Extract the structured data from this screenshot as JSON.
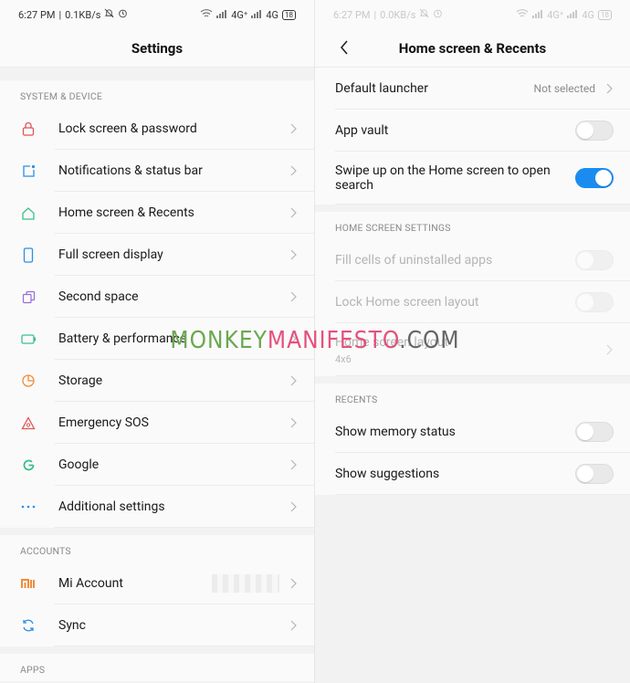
{
  "left": {
    "status": {
      "time": "6:27 PM",
      "speed": "0.1KB/s",
      "net1": "4G⁺",
      "net2": "4G",
      "battery": "18"
    },
    "title": "Settings",
    "sections": [
      {
        "header": "SYSTEM & DEVICE",
        "items": [
          {
            "label": "Lock screen & password",
            "icon": "lock-icon",
            "color": "#e05555"
          },
          {
            "label": "Notifications & status bar",
            "icon": "notification-icon",
            "color": "#2d8ee8"
          },
          {
            "label": "Home screen & Recents",
            "icon": "home-icon",
            "color": "#3cbf8a"
          },
          {
            "label": "Full screen display",
            "icon": "phone-icon",
            "color": "#2d8ee8"
          },
          {
            "label": "Second space",
            "icon": "second-space-icon",
            "color": "#9b6bd6"
          },
          {
            "label": "Battery & performance",
            "icon": "battery-icon",
            "color": "#3cbf8a"
          },
          {
            "label": "Storage",
            "icon": "storage-icon",
            "color": "#f08c3c"
          },
          {
            "label": "Emergency SOS",
            "icon": "sos-icon",
            "color": "#e05555"
          },
          {
            "label": "Google",
            "icon": "google-icon",
            "color": "#3cbf8a"
          },
          {
            "label": "Additional settings",
            "icon": "more-icon",
            "color": "#2d8ee8"
          }
        ]
      },
      {
        "header": "ACCOUNTS",
        "items": [
          {
            "label": "Mi Account",
            "icon": "mi-icon",
            "color": "#f08c3c"
          },
          {
            "label": "Sync",
            "icon": "sync-icon",
            "color": "#2d8ee8"
          }
        ]
      },
      {
        "header": "APPS",
        "items": []
      }
    ]
  },
  "right": {
    "status": {
      "time": "6:27 PM",
      "speed": "0.0KB/s",
      "net1": "4G⁺",
      "net2": "4G",
      "battery": "18"
    },
    "title": "Home screen & Recents",
    "rows_top": [
      {
        "label": "Default launcher",
        "value": "Not selected"
      },
      {
        "label": "App vault",
        "toggle": "off"
      },
      {
        "label": "Swipe up on the Home screen to open search",
        "toggle": "on"
      }
    ],
    "home_header": "HOME SCREEN SETTINGS",
    "home_rows": [
      {
        "label": "Fill cells of uninstalled apps"
      },
      {
        "label": "Lock Home screen layout"
      },
      {
        "label": "Home screen layout",
        "sub": "4x6"
      }
    ],
    "recents_header": "RECENTS",
    "recents_rows": [
      {
        "label": "Show memory status"
      },
      {
        "label": "Show suggestions"
      }
    ]
  },
  "watermark": {
    "part1": "MONKEY",
    "part2": "MANIFESTO",
    "part3": ".COM"
  }
}
